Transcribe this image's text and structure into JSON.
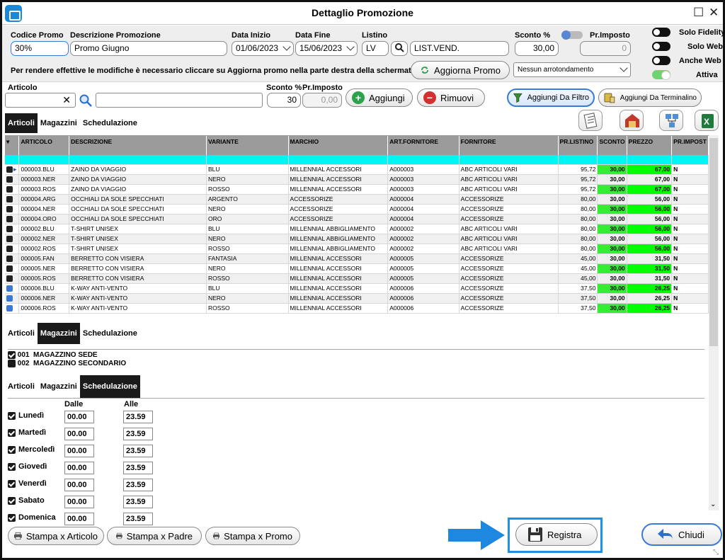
{
  "window": {
    "title": "Dettaglio Promozione"
  },
  "header": {
    "codice_label": "Codice Promo",
    "codice_value": "30%",
    "descr_label": "Descrizione Promozione",
    "descr_value": "Promo Giugno",
    "inizio_label": "Data Inizio",
    "inizio_value": "01/06/2023",
    "fine_label": "Data Fine",
    "fine_value": "15/06/2023",
    "listino_label": "Listino",
    "listino_code": "LV",
    "listino_name": "LIST.VEND.",
    "sconto_label": "Sconto %",
    "sconto_value": "30,00",
    "primposto_label": "Pr.Imposto",
    "primposto_value": "0",
    "notice": "Per rendere effettive le modifiche è necessario cliccare su Aggiorna promo nella parte destra della schermata.",
    "aggiorna_label": "Aggiorna Promo",
    "arrotondamento_value": "Nessun arrotondamento",
    "toggles": [
      {
        "label": "Solo Fidelity",
        "state": "off"
      },
      {
        "label": "Solo Web",
        "state": "off"
      },
      {
        "label": "Anche Web",
        "state": "off"
      },
      {
        "label": "Attiva",
        "state": "on"
      }
    ]
  },
  "articolo_bar": {
    "articolo_label": "Articolo",
    "sconto_label": "Sconto %",
    "primposto_label": "Pr.Imposto",
    "sconto_value": "30",
    "primposto_value": "0,00",
    "aggiungi_label": "Aggiungi",
    "rimuovi_label": "Rimuovi",
    "filtro_label": "Aggiungi Da Filtro",
    "terminalino_label": "Aggiungi Da Terminalino"
  },
  "tabs": [
    "Articoli",
    "Magazzini",
    "Schedulazione"
  ],
  "grid": {
    "columns": [
      "ARTICOLO",
      "DESCRIZIONE",
      "VARIANTE",
      "MARCHIO",
      "ART.FORNITORE",
      "FORNITORE",
      "PR.LISTINO",
      "SCONTO",
      "PREZZO",
      "PR.IMPOST"
    ],
    "rows": [
      {
        "mark": "dark",
        "cells": [
          "000003.BLU",
          "ZAINO DA VIAGGIO",
          "BLU",
          "MILLENNIAL ACCESSORI",
          "A000003",
          "ABC ARTICOLI VARI",
          "95,72",
          "30,00",
          "67,00",
          "N"
        ]
      },
      {
        "mark": "dark",
        "cells": [
          "000003.NER",
          "ZAINO DA VIAGGIO",
          "NERO",
          "MILLENNIAL ACCESSORI",
          "A000003",
          "ABC ARTICOLI VARI",
          "95,72",
          "30,00",
          "67,00",
          "N"
        ]
      },
      {
        "mark": "dark",
        "cells": [
          "000003.ROS",
          "ZAINO DA VIAGGIO",
          "ROSSO",
          "MILLENNIAL ACCESSORI",
          "A000003",
          "ABC ARTICOLI VARI",
          "95,72",
          "30,00",
          "67,00",
          "N"
        ]
      },
      {
        "mark": "dark",
        "cells": [
          "000004.ARG",
          "OCCHIALI DA SOLE SPECCHIATI",
          "ARGENTO",
          "ACCESSORIZE",
          "A000004",
          "ACCESSORIZE",
          "80,00",
          "30,00",
          "56,00",
          "N"
        ]
      },
      {
        "mark": "dark",
        "cells": [
          "000004.NER",
          "OCCHIALI DA SOLE SPECCHIATI",
          "NERO",
          "ACCESSORIZE",
          "A000004",
          "ACCESSORIZE",
          "80,00",
          "30,00",
          "56,00",
          "N"
        ]
      },
      {
        "mark": "dark",
        "cells": [
          "000004.ORO",
          "OCCHIALI DA SOLE SPECCHIATI",
          "ORO",
          "ACCESSORIZE",
          "A000004",
          "ACCESSORIZE",
          "80,00",
          "30,00",
          "56,00",
          "N"
        ]
      },
      {
        "mark": "dark",
        "cells": [
          "000002.BLU",
          "T-SHIRT UNISEX",
          "BLU",
          "MILLENNIAL ABBIGLIAMENTO",
          "A000002",
          "ABC ARTICOLI VARI",
          "80,00",
          "30,00",
          "56,00",
          "N"
        ]
      },
      {
        "mark": "dark",
        "cells": [
          "000002.NER",
          "T-SHIRT UNISEX",
          "NERO",
          "MILLENNIAL ABBIGLIAMENTO",
          "A000002",
          "ABC ARTICOLI VARI",
          "80,00",
          "30,00",
          "56,00",
          "N"
        ]
      },
      {
        "mark": "dark",
        "cells": [
          "000002.ROS",
          "T-SHIRT UNISEX",
          "ROSSO",
          "MILLENNIAL ABBIGLIAMENTO",
          "A000002",
          "ABC ARTICOLI VARI",
          "80,00",
          "30,00",
          "56,00",
          "N"
        ]
      },
      {
        "mark": "dark",
        "cells": [
          "000005.FAN",
          "BERRETTO CON VISIERA",
          "FANTASIA",
          "MILLENNIAL ACCESSORI",
          "A000005",
          "ACCESSORIZE",
          "45,00",
          "30,00",
          "31,50",
          "N"
        ]
      },
      {
        "mark": "dark",
        "cells": [
          "000005.NER",
          "BERRETTO CON VISIERA",
          "NERO",
          "MILLENNIAL ACCESSORI",
          "A000005",
          "ACCESSORIZE",
          "45,00",
          "30,00",
          "31,50",
          "N"
        ]
      },
      {
        "mark": "dark",
        "cells": [
          "000005.ROS",
          "BERRETTO CON VISIERA",
          "ROSSO",
          "MILLENNIAL ACCESSORI",
          "A000005",
          "ACCESSORIZE",
          "45,00",
          "30,00",
          "31,50",
          "N"
        ]
      },
      {
        "mark": "blue",
        "cells": [
          "000006.BLU",
          "K-WAY ANTI-VENTO",
          "BLU",
          "MILLENNIAL ACCESSORI",
          "A000006",
          "ACCESSORIZE",
          "37,50",
          "30,00",
          "26,25",
          "N"
        ]
      },
      {
        "mark": "blue",
        "cells": [
          "000006.NER",
          "K-WAY ANTI-VENTO",
          "NERO",
          "MILLENNIAL ACCESSORI",
          "A000006",
          "ACCESSORIZE",
          "37,50",
          "30,00",
          "26,25",
          "N"
        ]
      },
      {
        "mark": "blue",
        "cells": [
          "000006.ROS",
          "K-WAY ANTI-VENTO",
          "ROSSO",
          "MILLENNIAL ACCESSORI",
          "A000006",
          "ACCESSORIZE",
          "37,50",
          "30,00",
          "26,25",
          "N"
        ]
      }
    ]
  },
  "magazzini": [
    {
      "code": "001",
      "name": "MAGAZZINO SEDE",
      "checked": true
    },
    {
      "code": "002",
      "name": "MAGAZZINO SECONDARIO",
      "checked": false
    }
  ],
  "schedulazione": {
    "dalle_label": "Dalle",
    "alle_label": "Alle",
    "days": [
      {
        "day": "Lunedì",
        "from": "00.00",
        "to": "23.59"
      },
      {
        "day": "Martedì",
        "from": "00.00",
        "to": "23.59"
      },
      {
        "day": "Mercoledì",
        "from": "00.00",
        "to": "23.59"
      },
      {
        "day": "Giovedì",
        "from": "00.00",
        "to": "23.59"
      },
      {
        "day": "Venerdì",
        "from": "00.00",
        "to": "23.59"
      },
      {
        "day": "Sabato",
        "from": "00.00",
        "to": "23.59"
      },
      {
        "day": "Domenica",
        "from": "00.00",
        "to": "23.59"
      }
    ]
  },
  "footer": {
    "stampa_articolo": "Stampa x Articolo",
    "stampa_padre": "Stampa x Padre",
    "stampa_promo": "Stampa x Promo",
    "registra": "Registra",
    "chiudi": "Chiudi"
  },
  "colors": {
    "accent": "#1e88d8",
    "highlight_border": "#1e90e6",
    "filter_row": "#00f5f5",
    "sconto_cell": "#33ee33",
    "prezzo_cell": "#00ff00",
    "header_bg": "#9b9b9b"
  }
}
